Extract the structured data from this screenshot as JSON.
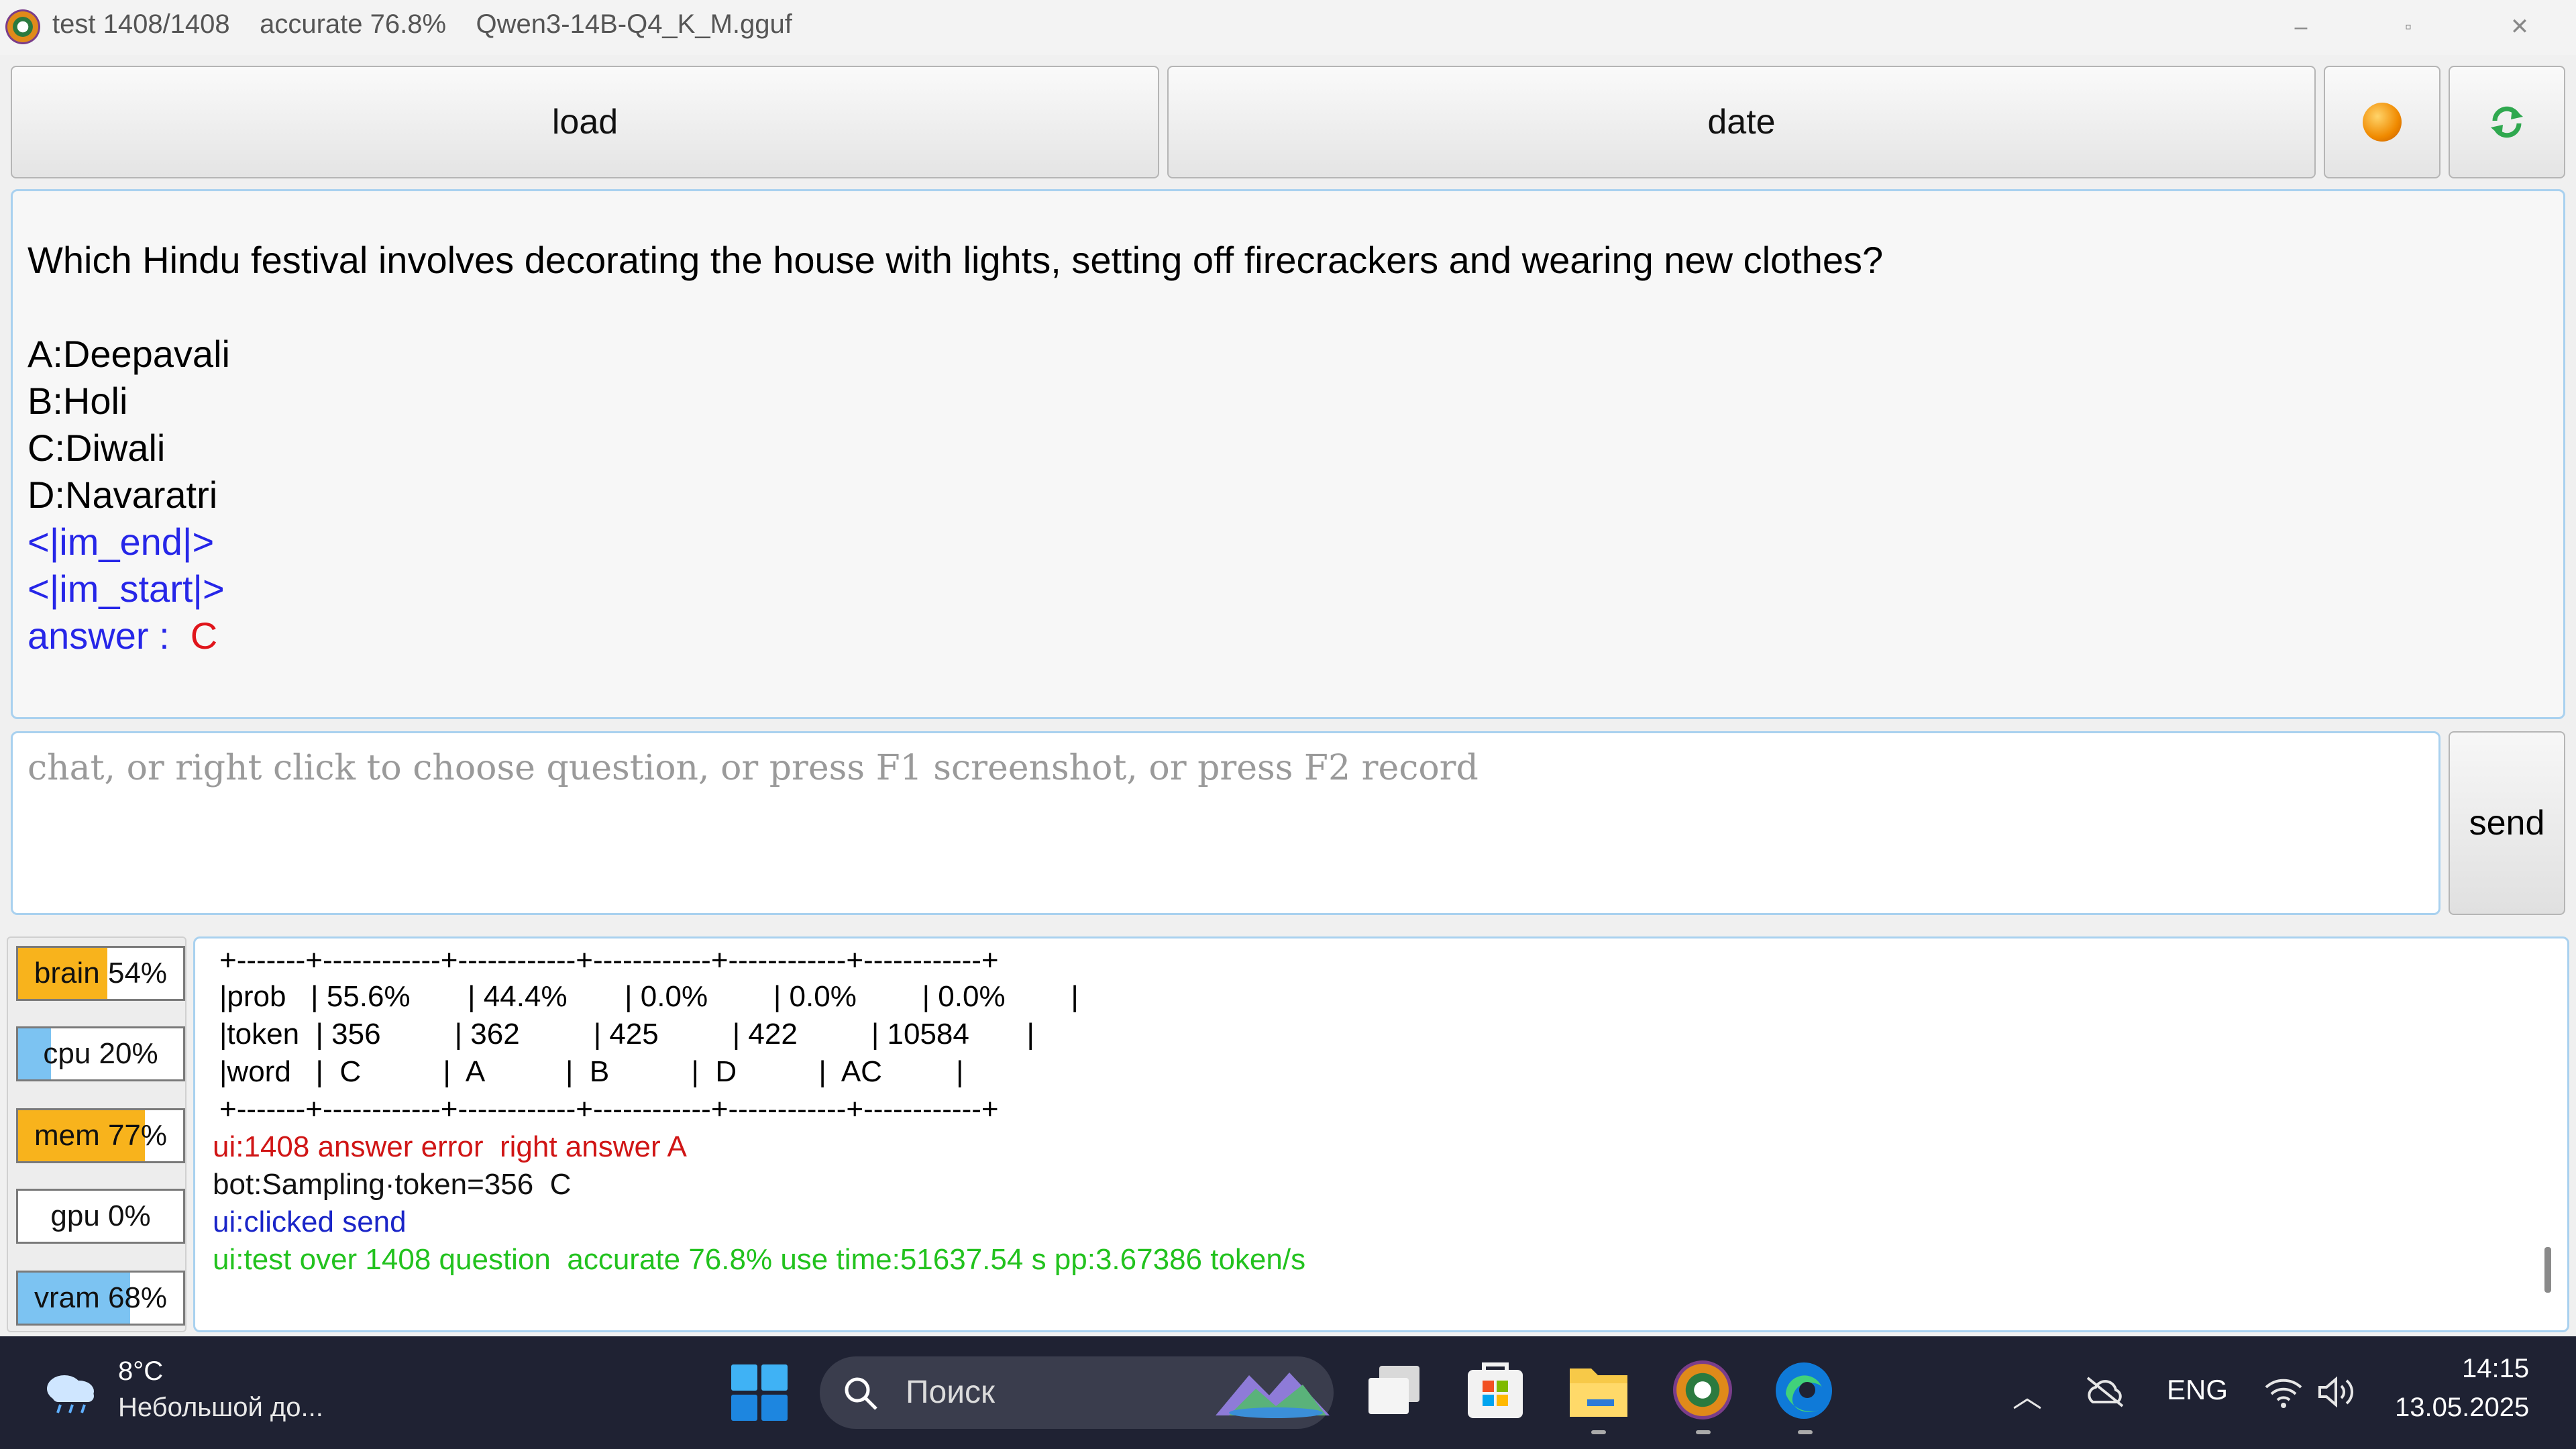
{
  "window": {
    "title": "test 1408/1408    accurate 76.8%    Qwen3-14B-Q4_K_M.gguf",
    "controls": {
      "minimize": "–",
      "restore": "▫",
      "close": "✕"
    }
  },
  "toolbar": {
    "load_label": "load",
    "date_label": "date"
  },
  "output": {
    "question": "Which Hindu festival involves decorating the house with lights, setting off firecrackers and wearing new clothes?",
    "options": [
      "A:Deepavali",
      "B:Holi",
      "C:Diwali",
      "D:Navaratri"
    ],
    "im_end": "<|im_end|>",
    "im_start": "<|im_start|>",
    "answer_label": "answer :",
    "answer_value": "C"
  },
  "chat": {
    "placeholder": "chat, or right click to choose question, or press F1 screenshot, or press F2 record",
    "send_label": "send"
  },
  "stats": [
    {
      "name": "brain",
      "label": "brain 54%",
      "percent": 54,
      "color": "#f8b31c"
    },
    {
      "name": "cpu",
      "label": "cpu 20%",
      "percent": 20,
      "color": "#7cc3f2"
    },
    {
      "name": "mem",
      "label": "mem 77%",
      "percent": 77,
      "color": "#f8b31c"
    },
    {
      "name": "gpu",
      "label": "gpu 0%",
      "percent": 0,
      "color": "#7cc3f2"
    },
    {
      "name": "vram",
      "label": "vram 68%",
      "percent": 68,
      "color": "#7cc3f2"
    }
  ],
  "log": {
    "table_border": "+-------+------------+------------+------------+------------+------------+",
    "table_rows": [
      "|prob   | 55.6%       | 44.4%       | 0.0%        | 0.0%        | 0.0%        |",
      "|token  | 356         | 362         | 425         | 422         | 10584       |",
      "|word   |  C          |  A          |  B          |  D          |  AC         |"
    ],
    "lines": [
      {
        "text": "ui:1408 answer error  right answer A",
        "style": "log-red"
      },
      {
        "text": "bot:Sampling·token=356  C",
        "style": "log-black"
      },
      {
        "text": "ui:clicked send",
        "style": "log-blue"
      },
      {
        "text": "ui:test over 1408 question  accurate 76.8% use time:51637.54 s pp:3.67386 token/s",
        "style": "log-green"
      }
    ]
  },
  "taskbar": {
    "temperature": "8°C",
    "weather_desc": "Небольшой до...",
    "search_placeholder": "Поиск",
    "language": "ENG",
    "time": "14:15",
    "date": "13.05.2025"
  }
}
